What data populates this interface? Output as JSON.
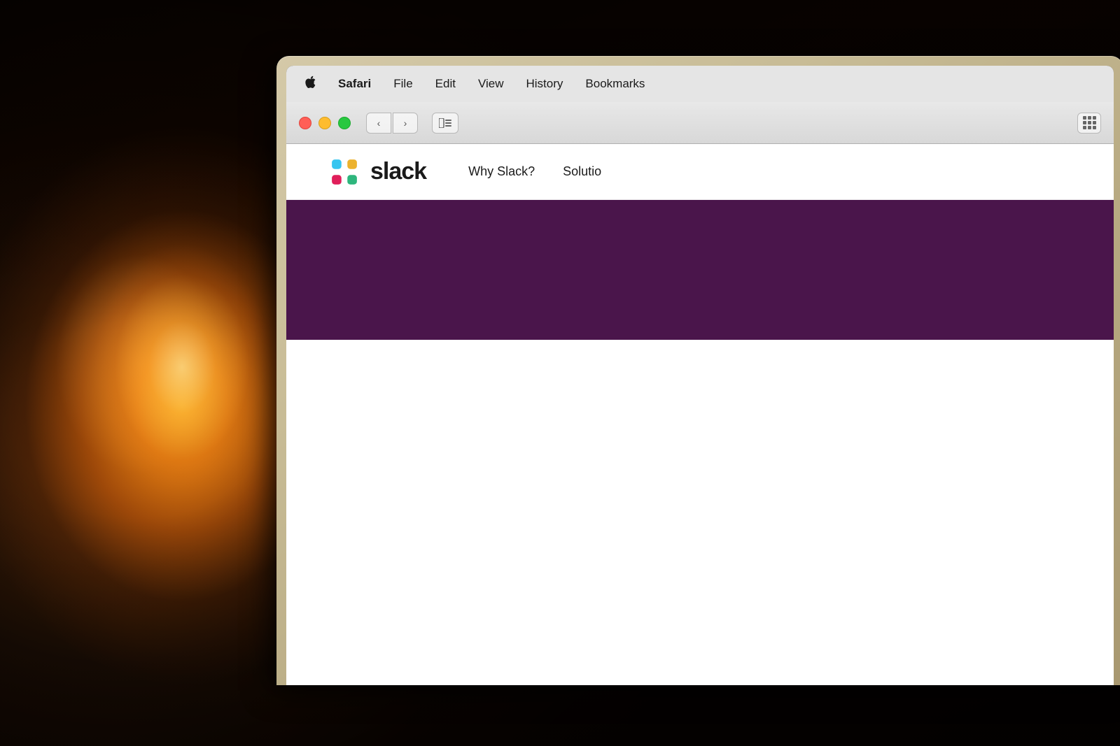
{
  "background": {
    "description": "Warm bokeh lamp photo background"
  },
  "mac_menu_bar": {
    "apple_icon": "🍎",
    "items": [
      {
        "id": "apple",
        "label": "",
        "bold": false,
        "is_apple": true
      },
      {
        "id": "safari",
        "label": "Safari",
        "bold": true
      },
      {
        "id": "file",
        "label": "File",
        "bold": false
      },
      {
        "id": "edit",
        "label": "Edit",
        "bold": false
      },
      {
        "id": "view",
        "label": "View",
        "bold": false
      },
      {
        "id": "history",
        "label": "History",
        "bold": false
      },
      {
        "id": "bookmarks",
        "label": "Bookmarks",
        "bold": false
      }
    ]
  },
  "browser_chrome": {
    "traffic_lights": [
      {
        "id": "close",
        "color": "red"
      },
      {
        "id": "minimize",
        "color": "yellow"
      },
      {
        "id": "maximize",
        "color": "green"
      }
    ],
    "back_button": "‹",
    "forward_button": "›",
    "sidebar_icon": "⬜",
    "grid_icon": "grid"
  },
  "slack_website": {
    "nav": {
      "logo_text": "slack",
      "nav_links": [
        {
          "id": "why-slack",
          "label": "Why Slack?"
        },
        {
          "id": "solutions",
          "label": "Solutio"
        }
      ]
    },
    "hero": {
      "background_color": "#4a154b"
    }
  },
  "colors": {
    "slack_purple": "#4a154b",
    "menu_bar_bg": "#ececec",
    "browser_chrome_bg": "#e0e0e0",
    "slack_blue": "#36c5f0",
    "slack_green": "#2eb67d",
    "slack_yellow": "#ecb22e",
    "slack_red": "#e01e5a"
  }
}
